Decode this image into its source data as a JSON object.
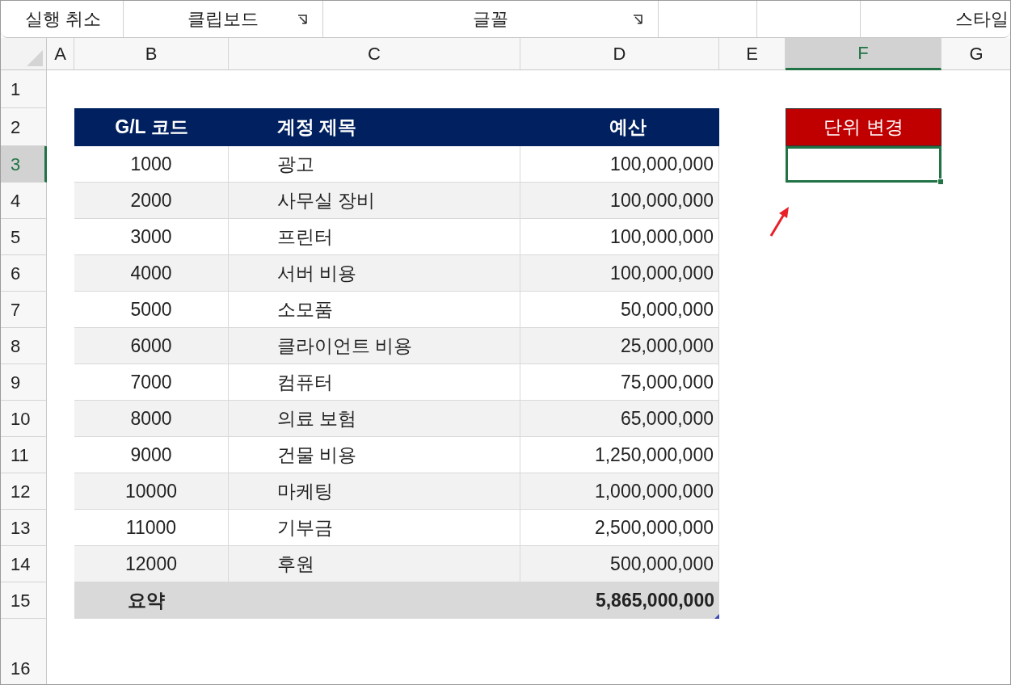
{
  "ribbon": {
    "groups": [
      {
        "label": "실행 취소",
        "launcher": false
      },
      {
        "label": "클립보드",
        "launcher": true
      },
      {
        "label": "글꼴",
        "launcher": true
      },
      {
        "launcher": false
      },
      {
        "launcher": false
      },
      {
        "label": "스타일",
        "launcher": false
      }
    ]
  },
  "columns": [
    {
      "label": "A",
      "selected": false
    },
    {
      "label": "B",
      "selected": false
    },
    {
      "label": "C",
      "selected": false
    },
    {
      "label": "D",
      "selected": false
    },
    {
      "label": "E",
      "selected": false
    },
    {
      "label": "F",
      "selected": true
    },
    {
      "label": "G",
      "selected": false
    }
  ],
  "rows": [
    {
      "label": "1",
      "selected": false
    },
    {
      "label": "2",
      "selected": false
    },
    {
      "label": "3",
      "selected": true
    },
    {
      "label": "4",
      "selected": false
    },
    {
      "label": "5",
      "selected": false
    },
    {
      "label": "6",
      "selected": false
    },
    {
      "label": "7",
      "selected": false
    },
    {
      "label": "8",
      "selected": false
    },
    {
      "label": "9",
      "selected": false
    },
    {
      "label": "10",
      "selected": false
    },
    {
      "label": "11",
      "selected": false
    },
    {
      "label": "12",
      "selected": false
    },
    {
      "label": "13",
      "selected": false
    },
    {
      "label": "14",
      "selected": false
    },
    {
      "label": "15",
      "selected": false
    },
    {
      "label": "16",
      "selected": false
    }
  ],
  "table": {
    "headers": [
      "G/L 코드",
      "계정 제목",
      "예산"
    ],
    "rows": [
      {
        "code": "1000",
        "title": "광고",
        "budget": "100,000,000"
      },
      {
        "code": "2000",
        "title": "사무실 장비",
        "budget": "100,000,000"
      },
      {
        "code": "3000",
        "title": "프린터",
        "budget": "100,000,000"
      },
      {
        "code": "4000",
        "title": "서버 비용",
        "budget": "100,000,000"
      },
      {
        "code": "5000",
        "title": "소모품",
        "budget": "50,000,000"
      },
      {
        "code": "6000",
        "title": "클라이언트 비용",
        "budget": "25,000,000"
      },
      {
        "code": "7000",
        "title": "컴퓨터",
        "budget": "75,000,000"
      },
      {
        "code": "8000",
        "title": "의료 보험",
        "budget": "65,000,000"
      },
      {
        "code": "9000",
        "title": "건물 비용",
        "budget": "1,250,000,000"
      },
      {
        "code": "10000",
        "title": "마케팅",
        "budget": "1,000,000,000"
      },
      {
        "code": "11000",
        "title": "기부금",
        "budget": "2,500,000,000"
      },
      {
        "code": "12000",
        "title": "후원",
        "budget": "500,000,000"
      }
    ],
    "summary": {
      "label": "요약",
      "value": "5,865,000,000"
    }
  },
  "unit_button": {
    "label": "단위 변경"
  }
}
